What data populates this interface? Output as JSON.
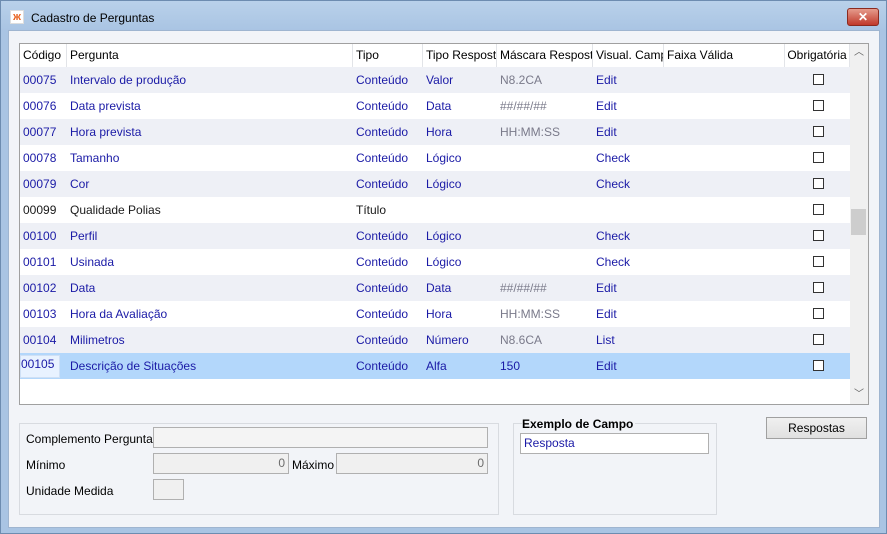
{
  "window": {
    "title": "Cadastro de Perguntas",
    "icon": "app-logo-icon",
    "close_icon": "close-icon"
  },
  "grid": {
    "columns": [
      "Código",
      "Pergunta",
      "Tipo",
      "Tipo Resposta",
      "Máscara Resposta",
      "Visual. Campo",
      "Faixa Válida",
      "Obrigatória"
    ],
    "rows": [
      {
        "codigo": "00075",
        "pergunta": "Intervalo de produção",
        "tipo": "Conteúdo",
        "tipo_resposta": "Valor",
        "mascara": "N8.2CA",
        "visual": "Edit",
        "faixa": "",
        "obrigatoria": false
      },
      {
        "codigo": "00076",
        "pergunta": "Data prevista",
        "tipo": "Conteúdo",
        "tipo_resposta": "Data",
        "mascara": "##/##/##",
        "visual": "Edit",
        "faixa": "",
        "obrigatoria": false
      },
      {
        "codigo": "00077",
        "pergunta": "Hora prevista",
        "tipo": "Conteúdo",
        "tipo_resposta": "Hora",
        "mascara": "HH:MM:SS",
        "visual": "Edit",
        "faixa": "",
        "obrigatoria": false
      },
      {
        "codigo": "00078",
        "pergunta": "Tamanho",
        "tipo": "Conteúdo",
        "tipo_resposta": "Lógico",
        "mascara": "",
        "visual": "Check",
        "faixa": "",
        "obrigatoria": false
      },
      {
        "codigo": "00079",
        "pergunta": "Cor",
        "tipo": "Conteúdo",
        "tipo_resposta": "Lógico",
        "mascara": "",
        "visual": "Check",
        "faixa": "",
        "obrigatoria": false
      },
      {
        "codigo": "00099",
        "pergunta": "Qualidade Polias",
        "tipo": "Título",
        "tipo_resposta": "",
        "mascara": "",
        "visual": "",
        "faixa": "",
        "obrigatoria": false
      },
      {
        "codigo": "00100",
        "pergunta": "Perfil",
        "tipo": "Conteúdo",
        "tipo_resposta": "Lógico",
        "mascara": "",
        "visual": "Check",
        "faixa": "",
        "obrigatoria": false
      },
      {
        "codigo": "00101",
        "pergunta": "Usinada",
        "tipo": "Conteúdo",
        "tipo_resposta": "Lógico",
        "mascara": "",
        "visual": "Check",
        "faixa": "",
        "obrigatoria": false
      },
      {
        "codigo": "00102",
        "pergunta": "Data",
        "tipo": "Conteúdo",
        "tipo_resposta": "Data",
        "mascara": "##/##/##",
        "visual": "Edit",
        "faixa": "",
        "obrigatoria": false
      },
      {
        "codigo": "00103",
        "pergunta": "Hora da Avaliação",
        "tipo": "Conteúdo",
        "tipo_resposta": "Hora",
        "mascara": "HH:MM:SS",
        "visual": "Edit",
        "faixa": "",
        "obrigatoria": false
      },
      {
        "codigo": "00104",
        "pergunta": "Milimetros",
        "tipo": "Conteúdo",
        "tipo_resposta": "Número",
        "mascara": "N8.6CA",
        "visual": "List",
        "faixa": "",
        "obrigatoria": false
      },
      {
        "codigo": "00105",
        "pergunta": "Descrição de Situações",
        "tipo": "Conteúdo",
        "tipo_resposta": "Alfa",
        "mascara": "150",
        "visual": "Edit",
        "faixa": "",
        "obrigatoria": false,
        "selected": true
      }
    ],
    "scroll_up_icon": "chevron-up-icon",
    "scroll_down_icon": "chevron-down-icon"
  },
  "details": {
    "complemento_label": "Complemento Pergunta",
    "complemento_value": "",
    "minimo_label": "Mínimo",
    "minimo_value": "0",
    "maximo_label": "Máximo",
    "maximo_value": "0",
    "unidade_label": "Unidade Medida",
    "unidade_value": ""
  },
  "exemplo": {
    "title": "Exemplo de Campo",
    "value": "Resposta"
  },
  "respostas_button": "Respostas",
  "colors": {
    "selected_row": "#b3d7fb",
    "link_text": "#1a1aa6",
    "alt_row": "#eef0f6"
  }
}
